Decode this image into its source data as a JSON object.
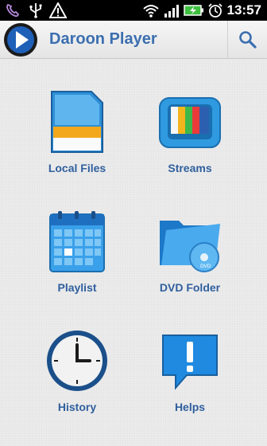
{
  "statusbar": {
    "time": "13:57",
    "icons": [
      "viber-icon",
      "usb-icon",
      "warning-icon",
      "wifi-icon",
      "signal-icon",
      "battery-charging-icon",
      "alarm-icon"
    ]
  },
  "app": {
    "title": "Daroon Player",
    "logo_icon": "play-logo-icon",
    "search_icon": "search-icon"
  },
  "menu": {
    "items": [
      {
        "label": "Local Files",
        "icon": "sd-card-icon"
      },
      {
        "label": "Streams",
        "icon": "tv-icon"
      },
      {
        "label": "Playlist",
        "icon": "calendar-icon"
      },
      {
        "label": "DVD Folder",
        "icon": "dvd-folder-icon"
      },
      {
        "label": "History",
        "icon": "clock-icon"
      },
      {
        "label": "Helps",
        "icon": "help-bubble-icon"
      }
    ]
  },
  "colors": {
    "accent": "#3b6fb0",
    "label": "#2f5f9e",
    "icon_blue": "#2a8fd6"
  }
}
